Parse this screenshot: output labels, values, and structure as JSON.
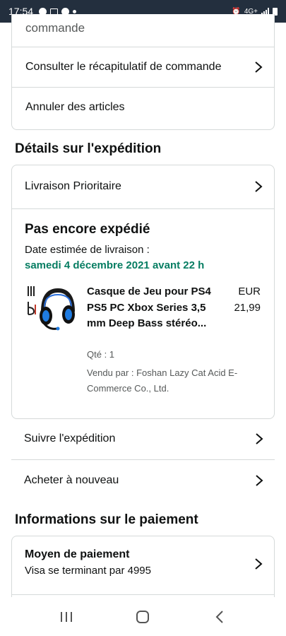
{
  "status_bar": {
    "time": "17:54",
    "network": "4G+"
  },
  "order_card": {
    "partial_row": "commande",
    "summary_label": "Consulter le récapitulatif de commande",
    "cancel_label": "Annuler des articles"
  },
  "shipping": {
    "section_title": "Détails sur l'expédition",
    "delivery_option": "Livraison Prioritaire",
    "status": "Pas encore expédié",
    "estimate_label": "Date estimée de livraison :",
    "estimate_date": "samedi 4 décembre 2021 avant 22 h",
    "product": {
      "title": "Casque de Jeu pour PS4 PS5 PC Xbox Series 3,5 mm Deep Bass stéréo...",
      "currency": "EUR",
      "price": "21,99",
      "qty": "Qté : 1",
      "seller": "Vendu par : Foshan Lazy Cat Acid E-Commerce Co., Ltd."
    },
    "track_label": "Suivre l'expédition",
    "buy_again_label": "Acheter à nouveau"
  },
  "payment": {
    "section_title": "Informations sur le paiement",
    "method_label": "Moyen de paiement",
    "method_value": "Visa se terminant par 4995"
  },
  "colors": {
    "status_bar_bg": "#232f3e",
    "delivery_date_green": "#067d62",
    "border": "#d5d9d9"
  }
}
